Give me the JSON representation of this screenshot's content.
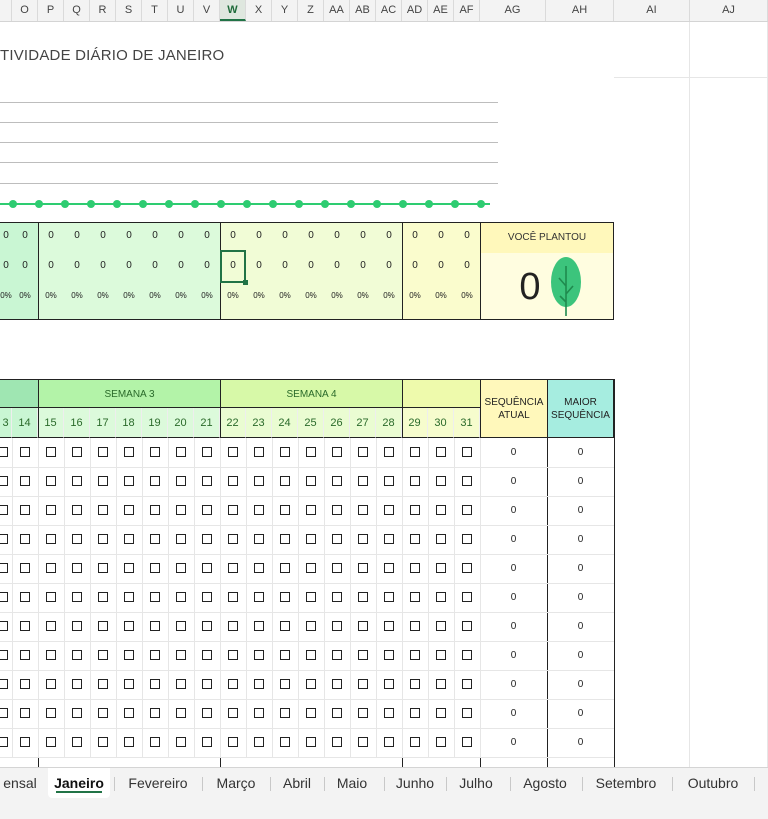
{
  "columns": [
    "O",
    "P",
    "Q",
    "R",
    "S",
    "T",
    "U",
    "V",
    "W",
    "X",
    "Y",
    "Z",
    "AA",
    "AB",
    "AC",
    "AD",
    "AE",
    "AF",
    "AG",
    "AH",
    "AI",
    "AJ"
  ],
  "selected_column": "W",
  "chart_title": "TIVIDADE DIÁRIO DE JANEIRO",
  "day_values": [
    "0",
    "0",
    "0",
    "0",
    "0",
    "0",
    "0",
    "0",
    "0",
    "0",
    "0",
    "0",
    "0",
    "0",
    "0",
    "0",
    "0",
    "0"
  ],
  "day_pct": "0%",
  "plant_panel": {
    "label": "VOCÊ PLANTOU",
    "value": "0"
  },
  "weeks": {
    "week3": "SEMANA 3",
    "week4": "SEMANA 4"
  },
  "days": [
    "3",
    "14",
    "15",
    "16",
    "17",
    "18",
    "19",
    "20",
    "21",
    "22",
    "23",
    "24",
    "25",
    "26",
    "27",
    "28",
    "29",
    "30",
    "31"
  ],
  "streak_headers": {
    "current": "SEQUÊNCIA ATUAL",
    "max": "MAIOR SEQUÊNCIA"
  },
  "streak_values": [
    "0",
    "0",
    "0",
    "0",
    "0",
    "0",
    "0",
    "0",
    "0",
    "0",
    "0"
  ],
  "sheet_tabs": [
    "ensal",
    "Janeiro",
    "Fevereiro",
    "Março",
    "Abril",
    "Maio",
    "Junho",
    "Julho",
    "Agosto",
    "Setembro",
    "Outubro"
  ],
  "active_tab": "Janeiro",
  "colors": {
    "week2_bg": "#c9f6d3",
    "week3_bg": "#dcfadb",
    "week4_bg": "#f1fcd6",
    "week5_bg": "#fafccd",
    "plant_bg": "#fffde0",
    "plant_header": "#fff8bb",
    "max_seq": "#a6ede0",
    "accent": "#2ecc71",
    "tree": "#3cc47c"
  }
}
